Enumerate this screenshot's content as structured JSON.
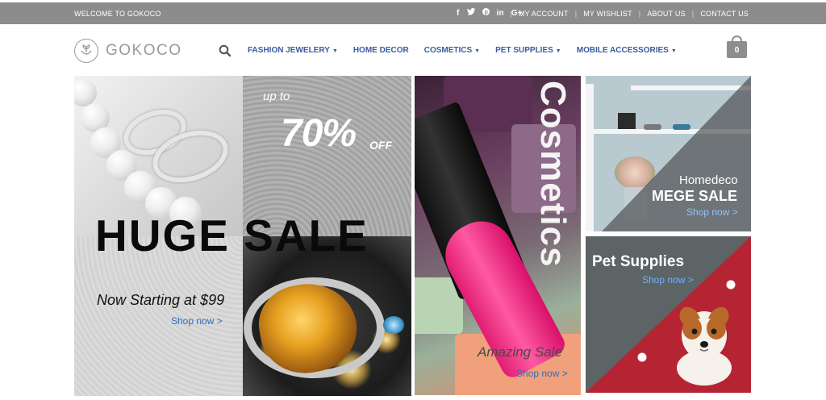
{
  "topbar": {
    "welcome": "WELCOME TO GOKOCO",
    "social": [
      "f",
      "t",
      "p",
      "in",
      "G+"
    ],
    "links": [
      "MY ACCOUNT",
      "MY WISHLIST",
      "ABOUT US",
      "CONTACT US"
    ],
    "separator": "|"
  },
  "header": {
    "brand": "GOKOCO",
    "nav": [
      {
        "label": "FASHION JEWELERY",
        "caret": "▼"
      },
      {
        "label": "HOME DECOR",
        "caret": ""
      },
      {
        "label": "COSMETICS",
        "caret": "▼"
      },
      {
        "label": "PET SUPPLIES",
        "caret": "▼"
      },
      {
        "label": "MOBILE ACCESSORIES",
        "caret": "▼"
      }
    ],
    "cart_count": "0"
  },
  "banners": {
    "sale": {
      "upto": "up to",
      "percent": "70%",
      "off": "OFF",
      "headline": "HUGE SALE",
      "starting": "Now Starting at $99",
      "shop": "Shop now >"
    },
    "cosmetics": {
      "word": "Cosmetics",
      "sub": "Amazing Sale",
      "shop": "Shop now >"
    },
    "home": {
      "line1": "Homedeco",
      "line2": "MEGE SALE",
      "shop": "Shop now >"
    },
    "pet": {
      "title": "Pet Supplies",
      "shop": "Shop now >"
    }
  },
  "colors": {
    "topbar": "#8c8c8c",
    "nav": "#3a5c9e",
    "link": "#2f6fb8"
  }
}
